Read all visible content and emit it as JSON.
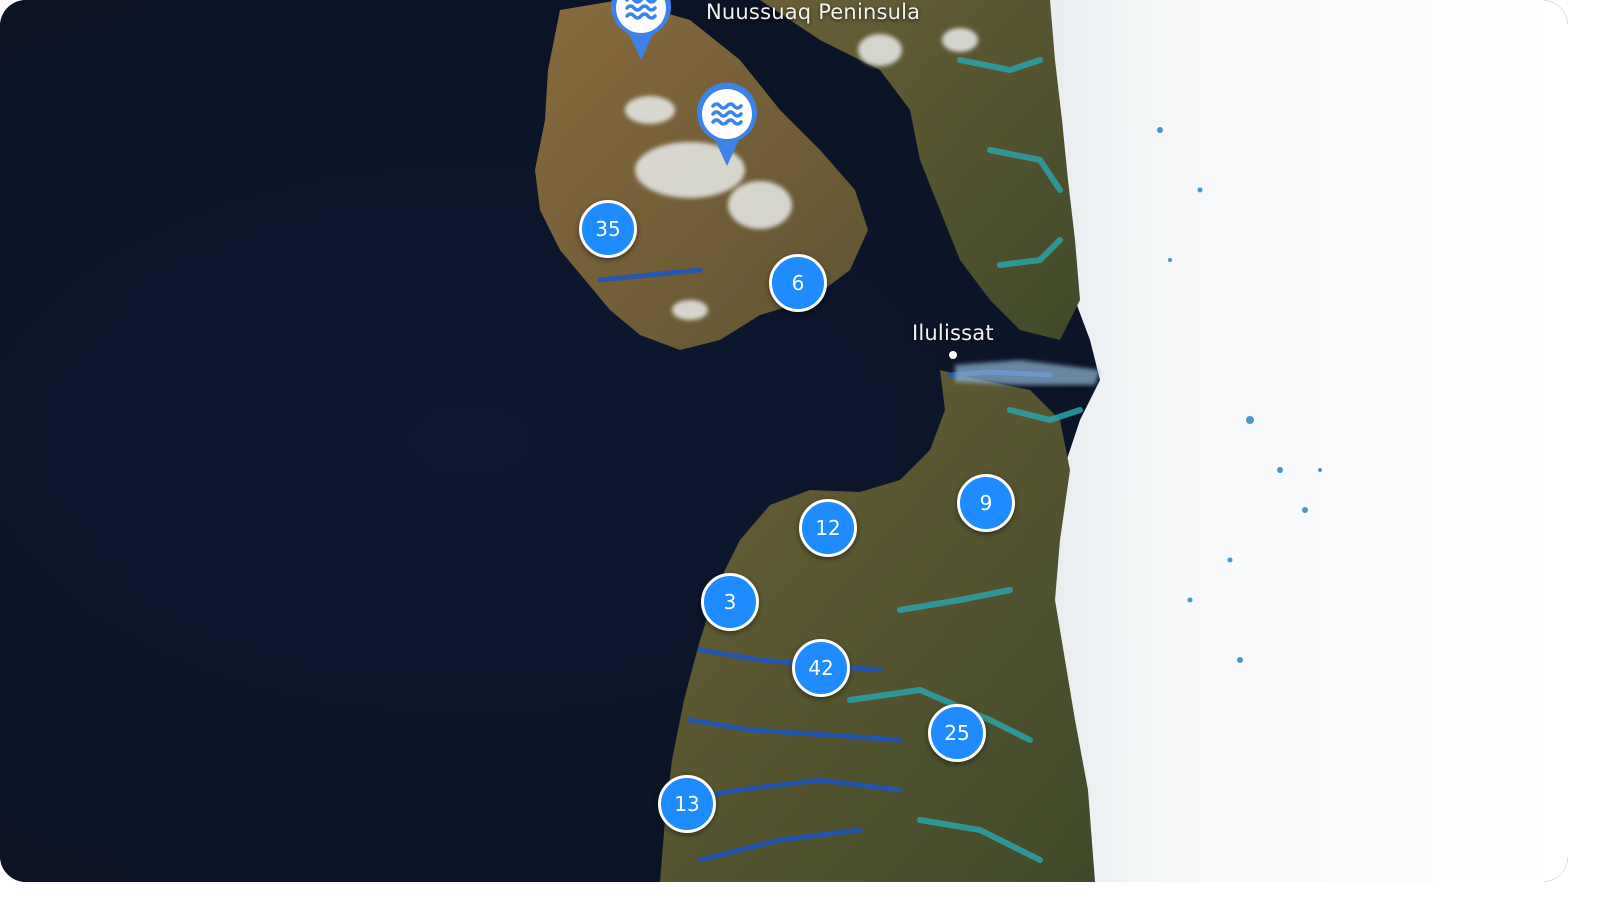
{
  "map": {
    "labels": {
      "nuussuaq": "Nuussuaq Peninsula",
      "ilulissat": "Ilulissat"
    },
    "clusters": [
      {
        "id": "c35",
        "count": "35"
      },
      {
        "id": "c6",
        "count": "6"
      },
      {
        "id": "c12",
        "count": "12"
      },
      {
        "id": "c9",
        "count": "9"
      },
      {
        "id": "c3",
        "count": "3"
      },
      {
        "id": "c42",
        "count": "42"
      },
      {
        "id": "c25",
        "count": "25"
      },
      {
        "id": "c13",
        "count": "13"
      }
    ],
    "pins": [
      {
        "id": "pin-1",
        "icon": "water-waves-icon"
      },
      {
        "id": "pin-2",
        "icon": "water-waves-icon"
      }
    ],
    "colors": {
      "cluster": "#1e8bff",
      "pin": "#3d82e6",
      "ocean": "#0b1324",
      "ice": "#f4f6f7",
      "land": "#5b5a34"
    }
  }
}
